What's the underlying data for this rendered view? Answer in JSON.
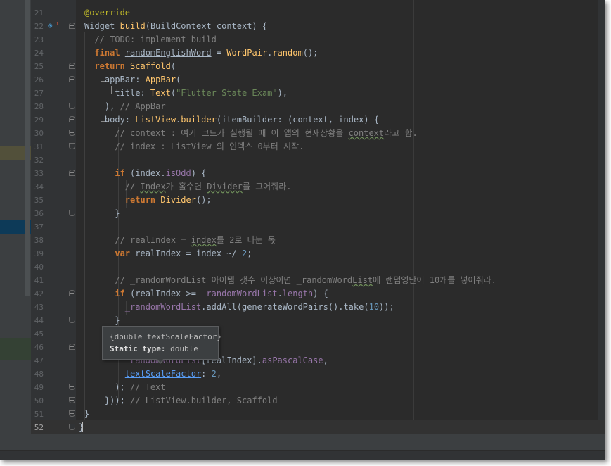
{
  "editor": {
    "lines": [
      {
        "n": "21",
        "html": "<span class='an'>@override</span>"
      },
      {
        "n": "22",
        "html": "<span class='lbl'>Widget</span> <span class='fn'>build</span>(BuildContext context) {"
      },
      {
        "n": "23",
        "html": "  <span class='c'>// TODO: implement build</span>"
      },
      {
        "n": "24",
        "html": "  <span class='k'>final</span> <span class='u'>randomEnglishWord</span> = <span class='t'>WordPair</span>.<span class='t'>random</span>();"
      },
      {
        "n": "25",
        "html": "  <span class='k'>return</span> <span class='t'>Scaffold</span>("
      },
      {
        "n": "26",
        "html": "    appBar: <span class='t'>AppBar</span>("
      },
      {
        "n": "27",
        "html": "      title: <span class='t'>Text</span>(<span class='s'>\"Flutter State Exam\"</span>),"
      },
      {
        "n": "28",
        "html": "    ), <span class='c'>// AppBar</span>"
      },
      {
        "n": "29",
        "html": "    body: <span class='t'>ListView</span>.<span class='t'>builder</span>(itemBuilder: (context, index) {"
      },
      {
        "n": "30",
        "html": "      <span class='c'>// context : 여기 코드가 실행될 때 이 앱의 현재상황을 <span class='squig'>context</span>라고 함.</span>"
      },
      {
        "n": "31",
        "html": "      <span class='c'>// index : ListView 의 인덱스 0부터 시작.</span>"
      },
      {
        "n": "32",
        "html": ""
      },
      {
        "n": "33",
        "html": "      <span class='k'>if</span> (index.<span class='p'>isOdd</span>) {"
      },
      {
        "n": "34",
        "html": "        <span class='c'>// <span class='squig'>Index</span>가 홀수면 <span class='squig'>Divider</span>를 그어줘라.</span>"
      },
      {
        "n": "35",
        "html": "        <span class='k'>return</span> <span class='t'>Divider</span>();"
      },
      {
        "n": "36",
        "html": "      }"
      },
      {
        "n": "37",
        "html": ""
      },
      {
        "n": "38",
        "html": "      <span class='c'>// realIndex = <span class='squig'>index</span>를 2로 나눈 몫</span>"
      },
      {
        "n": "39",
        "html": "      <span class='k'>var</span> realIndex = index ~/ <span class='n'>2</span>;"
      },
      {
        "n": "40",
        "html": ""
      },
      {
        "n": "41",
        "html": "      <span class='c'>// _randomWordList 아이템 갯수 이상이면 _randomWord<span class='squig'>List</span>에 랜덤영단어 10개를 넣어줘라.</span>"
      },
      {
        "n": "42",
        "html": "      <span class='k'>if</span> (realIndex >= <span class='p'>_randomWordList</span>.<span class='p'>length</span>) {"
      },
      {
        "n": "43",
        "html": "        <span class='p'>_randomWordList</span>.addAll(generateWordPairs().take(<span class='n'>10</span>));"
      },
      {
        "n": "44",
        "html": "      }"
      },
      {
        "n": "45",
        "html": ""
      },
      {
        "n": "46",
        "html": ""
      },
      {
        "n": "47",
        "html": "        <span class='p'>_randomWordList</span>[realIndex].<span class='p'>asPascalCase</span>,"
      },
      {
        "n": "48",
        "html": "        <span class='lnk'>textScaleFactor</span>: <span class='n'>2</span>,"
      },
      {
        "n": "49",
        "html": "      ); <span class='c'>// Text</span>"
      },
      {
        "n": "50",
        "html": "    })); <span class='c'>// ListView.builder, Scaffold</span>"
      },
      {
        "n": "51",
        "html": "}"
      },
      {
        "n": "52",
        "html": "}"
      }
    ],
    "current_line": "52"
  },
  "tooltip": {
    "line1": "{double textScaleFactor}",
    "line2_label": "Static type:",
    "line2_value": " double"
  }
}
